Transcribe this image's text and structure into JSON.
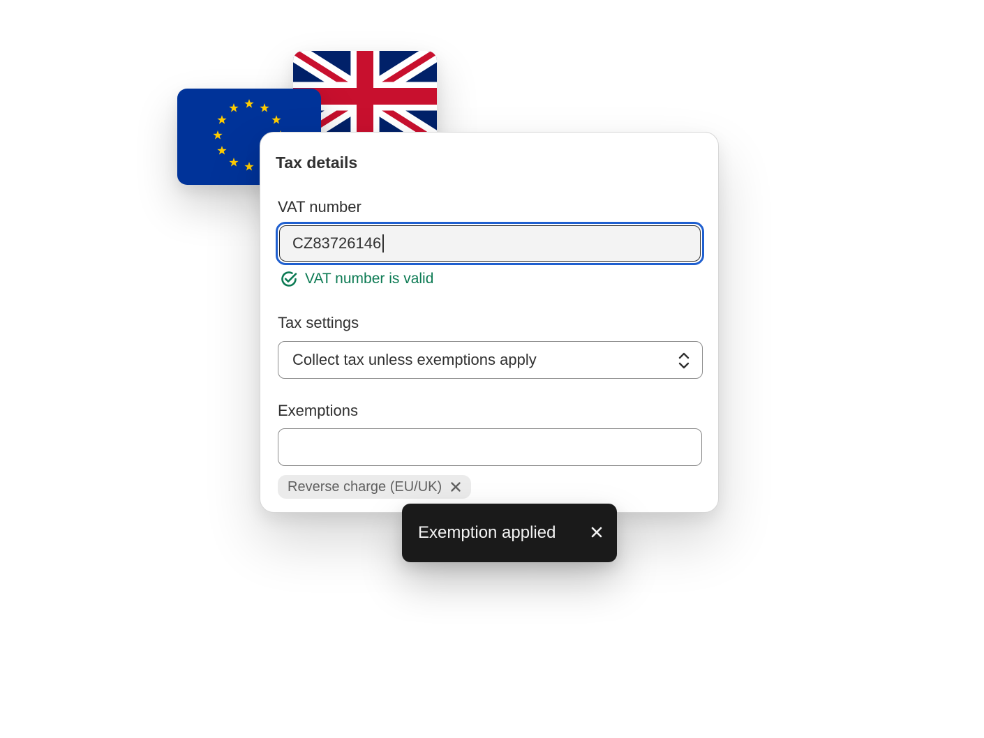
{
  "flags": {
    "eu": {
      "icon": "eu-flag-icon",
      "blue": "#003399",
      "star": "#FFCC00"
    },
    "uk": {
      "icon": "uk-flag-icon",
      "blue": "#012169",
      "red": "#C8102E"
    }
  },
  "card": {
    "title": "Tax details",
    "vat": {
      "label": "VAT number",
      "value": "CZ83726146",
      "validation": {
        "icon": "check-circle-icon",
        "text": "VAT number is valid",
        "color": "#0C7A53"
      }
    },
    "tax_settings": {
      "label": "Tax settings",
      "selected": "Collect tax unless exemptions apply",
      "icon": "select-chevron-icon"
    },
    "exemptions": {
      "label": "Exemptions",
      "value": "",
      "tags": [
        {
          "label": "Reverse charge (EU/UK)",
          "remove_icon": "close-icon"
        }
      ]
    }
  },
  "toast": {
    "message": "Exemption applied",
    "close_icon": "close-icon"
  }
}
